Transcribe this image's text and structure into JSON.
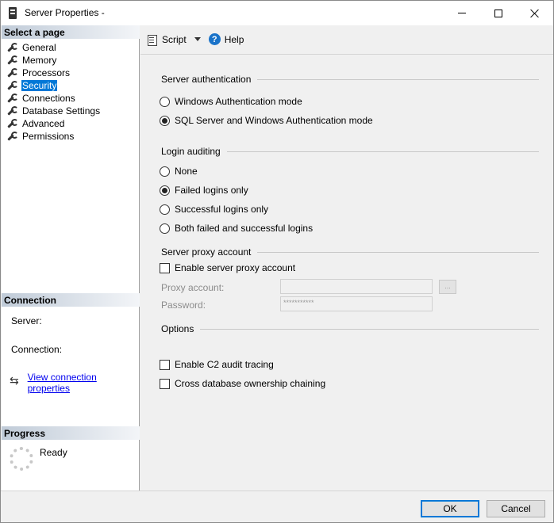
{
  "window": {
    "title": "Server Properties -"
  },
  "left_pane": {
    "select_page_header": "Select a page",
    "pages": [
      "General",
      "Memory",
      "Processors",
      "Security",
      "Connections",
      "Database Settings",
      "Advanced",
      "Permissions"
    ],
    "selected_page": "Security",
    "connection_header": "Connection",
    "server_label": "Server:",
    "connection_label": "Connection:",
    "view_connection_link": "View connection properties",
    "progress_header": "Progress",
    "progress_status": "Ready"
  },
  "toolbar": {
    "script_label": "Script",
    "help_label": "Help"
  },
  "main": {
    "server_auth": {
      "title": "Server authentication",
      "windows_mode": "Windows Authentication mode",
      "mixed_mode": "SQL Server and Windows Authentication mode",
      "selected": "mixed_mode"
    },
    "login_auditing": {
      "title": "Login auditing",
      "none": "None",
      "failed_only": "Failed logins only",
      "successful_only": "Successful logins only",
      "both": "Both failed and successful logins",
      "selected": "failed_only"
    },
    "proxy": {
      "title": "Server proxy account",
      "enable_label": "Enable server proxy account",
      "enabled": false,
      "account_label": "Proxy account:",
      "account_value": "",
      "password_label": "Password:",
      "password_value": "***********",
      "browse_label": "..."
    },
    "options": {
      "title": "Options",
      "c2_audit": "Enable C2 audit tracing",
      "c2_checked": false,
      "cross_db": "Cross database ownership chaining",
      "cross_checked": false
    }
  },
  "buttons": {
    "ok": "OK",
    "cancel": "Cancel"
  }
}
